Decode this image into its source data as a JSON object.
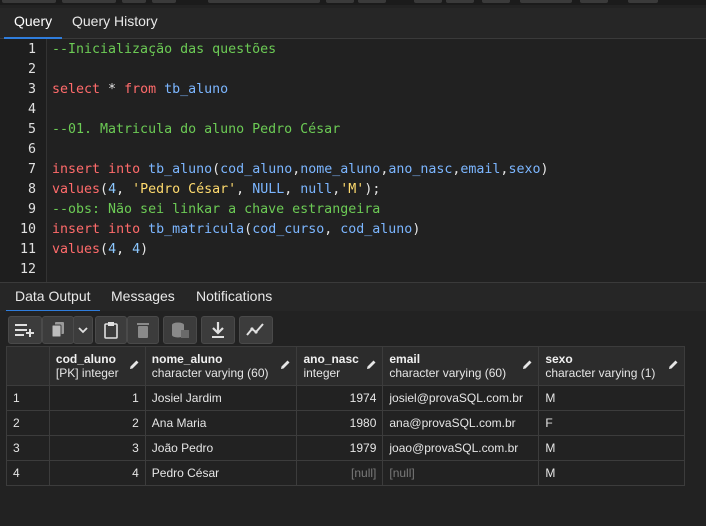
{
  "editor_tabs": [
    {
      "label": "Query",
      "active": true
    },
    {
      "label": "Query History",
      "active": false
    }
  ],
  "code_lines": [
    {
      "n": "1",
      "tokens": [
        {
          "t": "--Inicialização das questões",
          "c": "cm"
        }
      ]
    },
    {
      "n": "2",
      "tokens": []
    },
    {
      "n": "3",
      "tokens": [
        {
          "t": "select",
          "c": "kw"
        },
        {
          "t": " * ",
          "c": "op"
        },
        {
          "t": "from",
          "c": "kw"
        },
        {
          "t": " tb_aluno",
          "c": "id"
        }
      ]
    },
    {
      "n": "4",
      "tokens": []
    },
    {
      "n": "5",
      "tokens": [
        {
          "t": "--01. Matricula do aluno Pedro César",
          "c": "cm"
        }
      ]
    },
    {
      "n": "6",
      "tokens": []
    },
    {
      "n": "7",
      "tokens": [
        {
          "t": "insert",
          "c": "kw"
        },
        {
          "t": " ",
          "c": "op"
        },
        {
          "t": "into",
          "c": "kw"
        },
        {
          "t": " tb_aluno",
          "c": "id"
        },
        {
          "t": "(",
          "c": "op"
        },
        {
          "t": "cod_aluno",
          "c": "id"
        },
        {
          "t": ",",
          "c": "op"
        },
        {
          "t": "nome_aluno",
          "c": "id"
        },
        {
          "t": ",",
          "c": "op"
        },
        {
          "t": "ano_nasc",
          "c": "id"
        },
        {
          "t": ",",
          "c": "op"
        },
        {
          "t": "email",
          "c": "id"
        },
        {
          "t": ",",
          "c": "op"
        },
        {
          "t": "sexo",
          "c": "id"
        },
        {
          "t": ")",
          "c": "op"
        }
      ]
    },
    {
      "n": "8",
      "tokens": [
        {
          "t": "values",
          "c": "kw"
        },
        {
          "t": "(",
          "c": "op"
        },
        {
          "t": "4",
          "c": "num"
        },
        {
          "t": ", ",
          "c": "op"
        },
        {
          "t": "'Pedro César'",
          "c": "str"
        },
        {
          "t": ", ",
          "c": "op"
        },
        {
          "t": "NULL",
          "c": "nul"
        },
        {
          "t": ", ",
          "c": "op"
        },
        {
          "t": "null",
          "c": "nul"
        },
        {
          "t": ",",
          "c": "op"
        },
        {
          "t": "'M'",
          "c": "str"
        },
        {
          "t": ");",
          "c": "op"
        }
      ]
    },
    {
      "n": "9",
      "tokens": [
        {
          "t": "--obs: Não sei linkar a chave estrangeira",
          "c": "cm"
        }
      ]
    },
    {
      "n": "10",
      "tokens": [
        {
          "t": "insert",
          "c": "kw"
        },
        {
          "t": " ",
          "c": "op"
        },
        {
          "t": "into",
          "c": "kw"
        },
        {
          "t": " tb_matricula",
          "c": "id"
        },
        {
          "t": "(",
          "c": "op"
        },
        {
          "t": "cod_curso",
          "c": "id"
        },
        {
          "t": ", ",
          "c": "op"
        },
        {
          "t": "cod_aluno",
          "c": "id"
        },
        {
          "t": ")",
          "c": "op"
        }
      ]
    },
    {
      "n": "11",
      "tokens": [
        {
          "t": "values",
          "c": "kw"
        },
        {
          "t": "(",
          "c": "op"
        },
        {
          "t": "4",
          "c": "num"
        },
        {
          "t": ", ",
          "c": "op"
        },
        {
          "t": "4",
          "c": "num"
        },
        {
          "t": ")",
          "c": "op"
        }
      ]
    },
    {
      "n": "12",
      "tokens": []
    }
  ],
  "output_tabs": [
    {
      "label": "Data Output",
      "active": true
    },
    {
      "label": "Messages",
      "active": false
    },
    {
      "label": "Notifications",
      "active": false
    }
  ],
  "toolbar_icons": [
    "add-row-icon",
    "copy-icon",
    "chevron-down-icon",
    "paste-icon",
    "delete-icon",
    "save-data-icon",
    "download-icon",
    "graph-icon"
  ],
  "columns": [
    {
      "name": "cod_aluno",
      "type": "[PK] integer"
    },
    {
      "name": "nome_aluno",
      "type": "character varying (60)"
    },
    {
      "name": "ano_nasc",
      "type": "integer"
    },
    {
      "name": "email",
      "type": "character varying (60)"
    },
    {
      "name": "sexo",
      "type": "character varying (1)"
    }
  ],
  "rows": [
    {
      "n": "1",
      "cells": [
        "1",
        "Josiel Jardim",
        "1974",
        "josiel@provaSQL.com.br",
        "M"
      ]
    },
    {
      "n": "2",
      "cells": [
        "2",
        "Ana Maria",
        "1980",
        "ana@provaSQL.com.br",
        "F"
      ]
    },
    {
      "n": "3",
      "cells": [
        "3",
        "João Pedro",
        "1979",
        "joao@provaSQL.com.br",
        "M"
      ]
    },
    {
      "n": "4",
      "cells": [
        "4",
        "Pedro César",
        "[null]",
        "[null]",
        "M"
      ]
    }
  ],
  "colors": {
    "accent": "#2f7ddc",
    "keyword": "#ff6b6b",
    "comment": "#6ccb55",
    "identifier": "#7cb6ff",
    "string": "#ffdb6e"
  }
}
